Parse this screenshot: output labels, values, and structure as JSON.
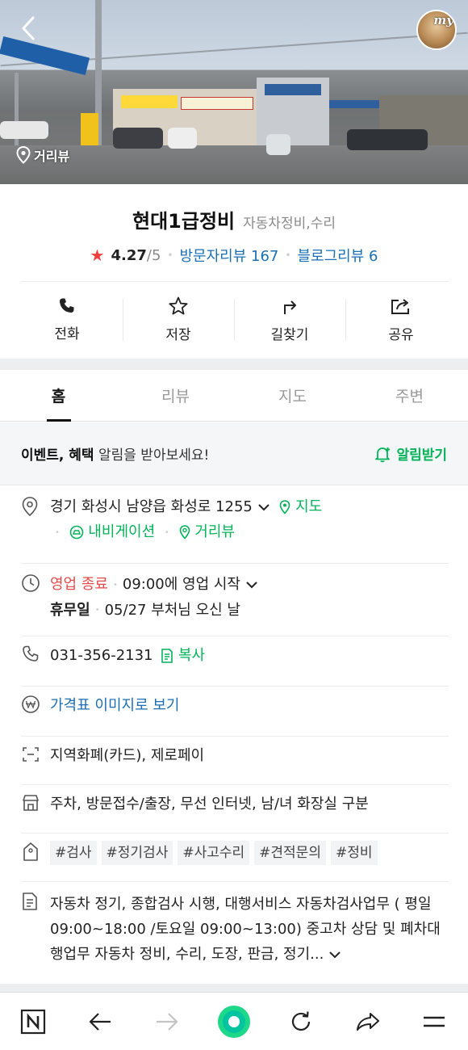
{
  "hero": {
    "street_view_label": "거리뷰",
    "avatar_text": "my"
  },
  "place": {
    "name": "현대1급정비",
    "category": "자동차정비,수리",
    "rating": "4.27",
    "rating_max": "/5",
    "visitor_reviews": "방문자리뷰 167",
    "blog_reviews": "블로그리뷰 6"
  },
  "actions": [
    {
      "label": "전화",
      "icon": "phone-icon"
    },
    {
      "label": "저장",
      "icon": "star-icon"
    },
    {
      "label": "길찾기",
      "icon": "directions-icon"
    },
    {
      "label": "공유",
      "icon": "share-icon"
    }
  ],
  "tabs": [
    {
      "label": "홈",
      "active": true
    },
    {
      "label": "리뷰",
      "active": false
    },
    {
      "label": "지도",
      "active": false
    },
    {
      "label": "주변",
      "active": false
    }
  ],
  "alarm": {
    "bold_text": "이벤트, 혜택",
    "text": " 알림을 받아보세요!",
    "button": "알림받기"
  },
  "address": {
    "value": "경기 화성시 남양읍 화성로 1255",
    "map_link": "지도",
    "navigation_link": "내비게이션",
    "street_view_link": "거리뷰"
  },
  "hours": {
    "status": "영업 종료",
    "next": "09:00에 영업 시작",
    "holiday_label": "휴무일",
    "holiday_value": "05/27 부처님 오신 날"
  },
  "phone": {
    "number": "031-356-2131",
    "copy": "복사"
  },
  "price": {
    "link": "가격표 이미지로 보기"
  },
  "payment": {
    "value": "지역화폐(카드), 제로페이"
  },
  "amenities": {
    "value": "주차, 방문접수/출장, 무선 인터넷, 남/녀 화장실 구분"
  },
  "tags": [
    "#검사",
    "#정기검사",
    "#사고수리",
    "#견적문의",
    "#정비"
  ],
  "description": {
    "value": "자동차 정기, 종합검사 시행, 대행서비스 자동차검사업무 ( 평일 09:00~18:00 /토요일 09:00~13:00) 중고차 상담 및 폐차대행업무 자동차 정비, 수리, 도장, 판금, 정기..."
  },
  "colors": {
    "accent_green": "#03b35a",
    "link_blue": "#1a6fb5",
    "closed_red": "#e44b4b",
    "rating_star": "#f43c3c"
  }
}
